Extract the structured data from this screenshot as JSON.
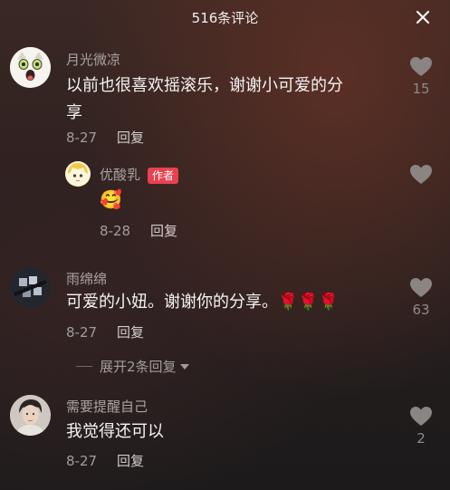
{
  "header": {
    "title": "516条评论"
  },
  "comments": [
    {
      "username": "月光微凉",
      "text_line1": "以前也很喜欢摇滚乐，谢谢小可爱的分",
      "text_line2": "享",
      "date": "8-27",
      "reply_label": "回复",
      "likes": "15",
      "avatar_icon": "cat-face-icon"
    },
    {
      "username": "优酸乳",
      "author_badge": "作者",
      "text": "🥰",
      "date": "8-28",
      "reply_label": "回复",
      "likes": "",
      "avatar_icon": "anime-blonde-icon"
    },
    {
      "username": "雨绵绵",
      "text": "可爱的小妞。谢谢你的分享。🌹🌹🌹",
      "date": "8-27",
      "reply_label": "回复",
      "likes": "63",
      "avatar_icon": "window-shadow-icon"
    },
    {
      "username": "需要提醒自己",
      "text": "我觉得还可以",
      "date": "8-27",
      "reply_label": "回复",
      "likes": "2",
      "avatar_icon": "man-portrait-icon"
    }
  ],
  "expand_replies": {
    "label": "展开2条回复"
  },
  "colors": {
    "background": "#2a201f",
    "badge": "#e8414f",
    "like_heart": "#8a8483"
  }
}
